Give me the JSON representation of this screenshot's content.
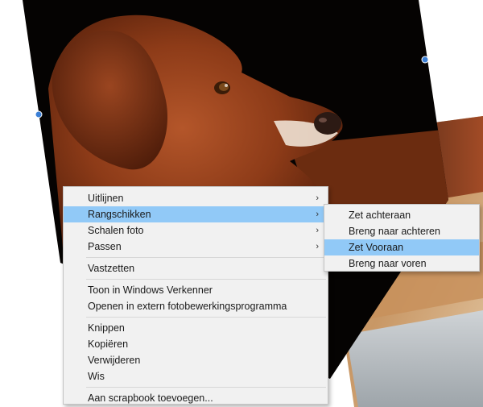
{
  "colors": {
    "menu_bg": "#f1f1f1",
    "highlight": "#91c9f7",
    "handle": "#3b7fd6"
  },
  "context_menu": {
    "groups": [
      [
        {
          "label": "Uitlijnen",
          "submenu": true
        },
        {
          "label": "Rangschikken",
          "submenu": true,
          "highlighted": true
        },
        {
          "label": "Schalen foto",
          "submenu": true
        },
        {
          "label": "Passen",
          "submenu": true
        }
      ],
      [
        {
          "label": "Vastzetten"
        }
      ],
      [
        {
          "label": "Toon in Windows Verkenner"
        },
        {
          "label": "Openen in extern fotobewerkingsprogramma"
        }
      ],
      [
        {
          "label": "Knippen"
        },
        {
          "label": "Kopiëren"
        },
        {
          "label": "Verwijderen"
        },
        {
          "label": "Wis"
        }
      ],
      [
        {
          "label": "Aan scrapbook toevoegen..."
        }
      ]
    ],
    "submenu_arrow": "›"
  },
  "submenu": {
    "items": [
      {
        "label": "Zet achteraan"
      },
      {
        "label": "Breng naar achteren"
      },
      {
        "label": "Zet Vooraan",
        "highlighted": true
      },
      {
        "label": "Breng naar voren"
      }
    ]
  }
}
